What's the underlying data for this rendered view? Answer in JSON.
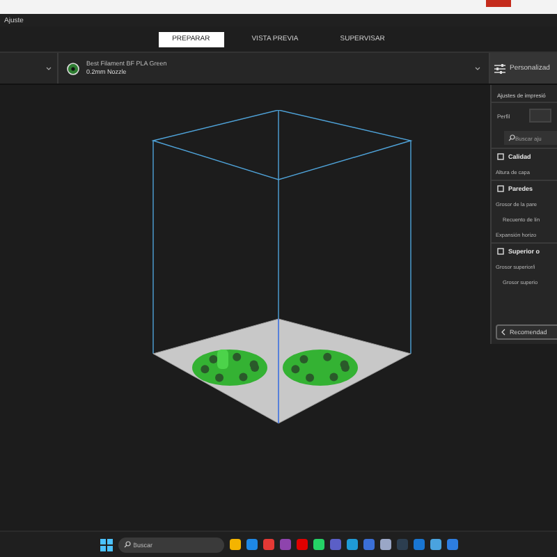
{
  "menu": {
    "title": "Ajuste"
  },
  "tabs": [
    {
      "label": "PREPARAR",
      "selected": true
    },
    {
      "label": "VISTA PREVIA",
      "selected": false
    },
    {
      "label": "SUPERVISAR",
      "selected": false
    }
  ],
  "toolbar": {
    "material": "Best Filament BF PLA Green",
    "nozzle": "0.2mm Nozzle",
    "mode_button": "Personalizad"
  },
  "panel": {
    "title": "Ajustes de impresió",
    "profile_label": "Perfil",
    "search": {
      "placeholder": "Buscar aju"
    },
    "rows": [
      {
        "kind": "section",
        "label": "Calidad"
      },
      {
        "kind": "setting",
        "label": "Altura de capa"
      },
      {
        "kind": "section",
        "label": "Paredes"
      },
      {
        "kind": "setting",
        "label": "Grosor de la pare"
      },
      {
        "kind": "subsetting",
        "label": "Recuento de lín"
      },
      {
        "kind": "setting",
        "label": "Expansión horizo"
      },
      {
        "kind": "section",
        "label": "Superior o"
      },
      {
        "kind": "setting",
        "label": "Grosor superior/i"
      },
      {
        "kind": "subsetting",
        "label": "Grosor superio"
      }
    ],
    "back_button": "Recomendad"
  },
  "taskbar": {
    "search": {
      "placeholder": "Buscar"
    }
  }
}
